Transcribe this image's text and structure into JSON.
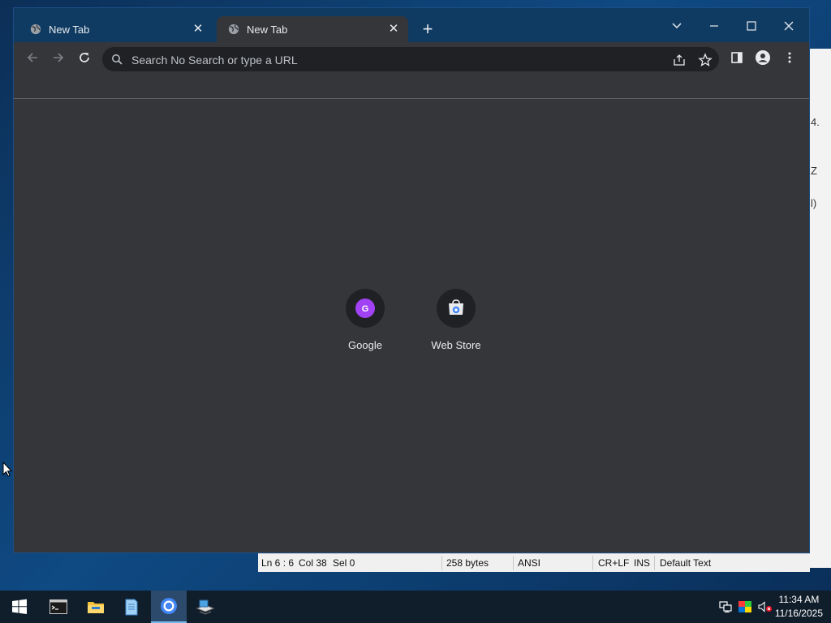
{
  "browser": {
    "tabs": [
      {
        "label": "New Tab",
        "active": false
      },
      {
        "label": "New Tab",
        "active": true
      }
    ],
    "omnibox": {
      "placeholder": "Search No Search or type a URL",
      "value": ""
    },
    "shortcuts": [
      {
        "label": "Google",
        "icon": "google-g-icon",
        "letter": "G",
        "color": "#a142f4"
      },
      {
        "label": "Web Store",
        "icon": "web-store-icon"
      }
    ],
    "colors": {
      "frame": "#0f3b62",
      "toolbar": "#35363a",
      "omnibox": "#202124"
    }
  },
  "notepad_status": {
    "position": "Ln 6 : 6",
    "column": "Col 38",
    "selection": "Sel 0",
    "size": "258 bytes",
    "encoding": "ANSI",
    "line_endings": "CR+LF",
    "mode": "INS",
    "scheme": "Default Text"
  },
  "background_window": {
    "glyphs": [
      "4.",
      "Z",
      "l)"
    ]
  },
  "taskbar": {
    "items": [
      "start-icon",
      "terminal-icon",
      "file-explorer-icon",
      "notepad-icon",
      "chrome-icon",
      "remote-desktop-icon"
    ],
    "active_item": "chrome-icon",
    "clock": {
      "time": "11:34 AM",
      "date": "11/16/2025"
    }
  }
}
